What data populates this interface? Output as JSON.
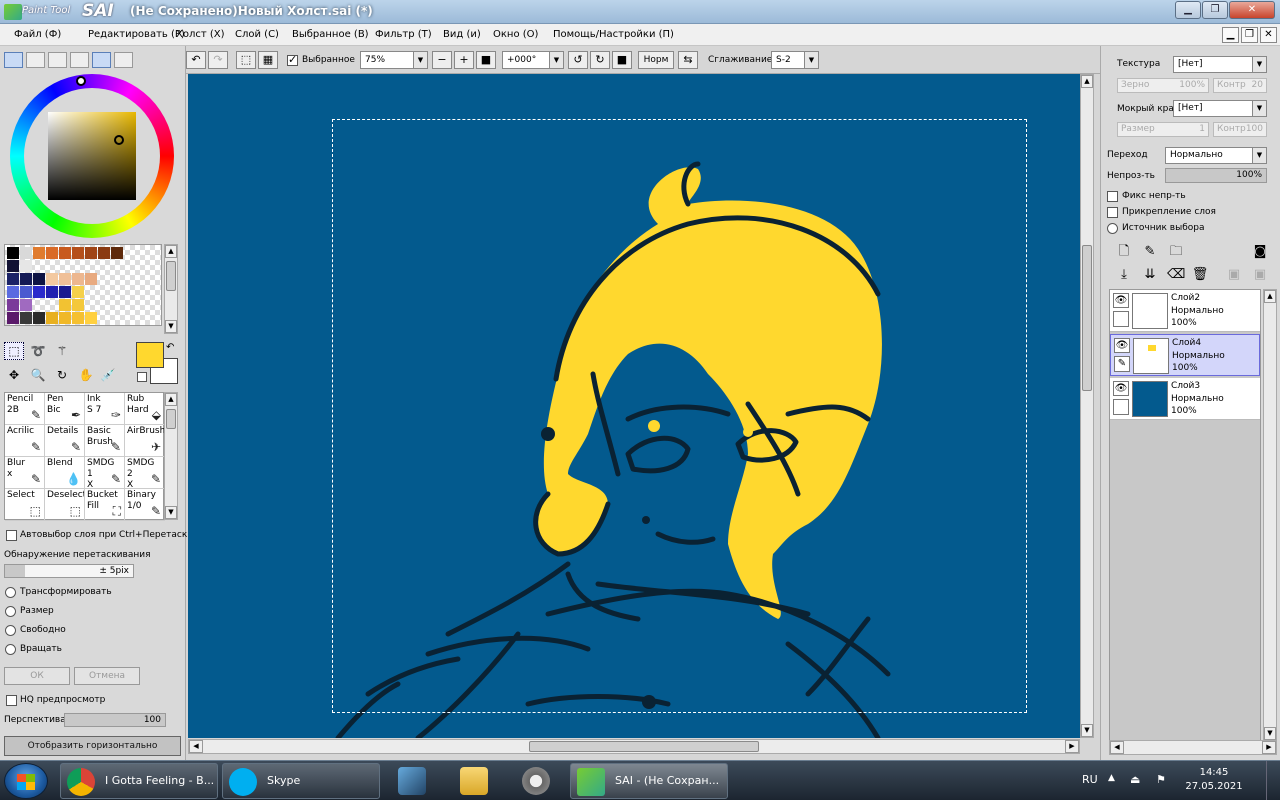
{
  "window": {
    "logo_small": "Paint Tool",
    "logo_big": "SAI",
    "title": "(Не Сохранено)Новый Холст.sai (*)",
    "buttons": [
      "minimize",
      "maximize",
      "close"
    ]
  },
  "menu": [
    "Файл (Ф)",
    "Редактировать (Р)",
    "Холст (Х)",
    "Слой (С)",
    "Выбранное (В)",
    "Фильтр (Т)",
    "Вид (и)",
    "Окно (О)",
    "Помощь/Настройки (П)"
  ],
  "toolbar": {
    "selected_label": "Выбранное",
    "selected_checked": true,
    "zoom": "75%",
    "rotation": "+000°",
    "mode": "Норм",
    "smoothing_label": "Сглаживание",
    "smoothing": "S-2"
  },
  "colors": {
    "canvas_bg": "#035a8e",
    "foreground": "#ffd82e",
    "background": "#ffffff",
    "hair": "#ffd82e"
  },
  "swatches": [
    {
      "color": "#000000"
    },
    {
      "color": "#d9d9d9"
    },
    {
      "color": "#e07b2e"
    },
    {
      "color": "#d96a27"
    },
    {
      "color": "#c85a1e"
    },
    {
      "color": "#b54f1a"
    },
    {
      "color": "#a04416"
    },
    {
      "color": "#8a3a12"
    },
    {
      "color": "#5e2a0c"
    },
    {
      "color": "#111133"
    },
    {
      "color": "#e6e6e6"
    },
    {
      "color": "#1b2266"
    },
    {
      "color": "#141a55"
    },
    {
      "color": "#0e1444"
    },
    {
      "color": "#f3c9a0"
    },
    {
      "color": "#f0c098"
    },
    {
      "color": "#edb78f"
    },
    {
      "color": "#e8aa80"
    },
    {
      "color": "#5a6ae0"
    },
    {
      "color": "#4a5ad0"
    },
    {
      "color": "#2a2acc"
    },
    {
      "color": "#2020b0"
    },
    {
      "color": "#1a1a90"
    },
    {
      "color": "#f5d04a"
    },
    {
      "color": "#7a3a9a"
    },
    {
      "color": "#a06ac0"
    },
    {
      "color": "#f2c232"
    },
    {
      "color": "#f4c83a"
    },
    {
      "color": "#5a1a6a"
    },
    {
      "color": "#3a3a3a"
    },
    {
      "color": "#2a2a2a"
    },
    {
      "color": "#e8b020"
    },
    {
      "color": "#f0b828"
    },
    {
      "color": "#f5c030"
    },
    {
      "color": "#ffd040"
    }
  ],
  "tools": [
    "selection-icon",
    "lasso-icon",
    "magic-wand-icon",
    "move-icon",
    "zoom-icon",
    "rotate-icon",
    "hand-icon",
    "eyedropper-icon"
  ],
  "brushes": [
    {
      "name": "Pencil",
      "size": "2B"
    },
    {
      "name": "Pen",
      "size": "Bic"
    },
    {
      "name": "Ink",
      "size": "S 7"
    },
    {
      "name": "Rub",
      "size": "Hard"
    },
    {
      "name": "Acrilic",
      "size": ""
    },
    {
      "name": "Details",
      "size": ""
    },
    {
      "name": "Basic",
      "size": "Brush"
    },
    {
      "name": "AirBrush",
      "size": ""
    },
    {
      "name": "Blur",
      "size": "x"
    },
    {
      "name": "Blend",
      "size": ""
    },
    {
      "name": "SMDG 1",
      "size": "X"
    },
    {
      "name": "SMDG 2",
      "size": "X"
    },
    {
      "name": "Select",
      "size": ""
    },
    {
      "name": "Deselect",
      "size": ""
    },
    {
      "name": "Bucket",
      "size": "Fill"
    },
    {
      "name": "Binary",
      "size": "1/0"
    }
  ],
  "left_options": {
    "auto_select": "Автовыбор слоя при Ctrl+Перетаскиван",
    "drag_detect": "Обнаружение перетаскивания",
    "drag_value": "± 5pix",
    "transform": "Трансформировать",
    "size": "Размер",
    "free": "Свободно",
    "rotate": "Вращать",
    "ok": "ОК",
    "cancel": "Отмена",
    "hq_preview": "HQ предпросмотр",
    "perspective": "Перспектива",
    "perspective_value": "100",
    "flip": "Отобразить горизонтально"
  },
  "right_panel": {
    "texture_label": "Текстура",
    "texture_value": "[Нет]",
    "grain_label": "Зерно",
    "grain_value": "100%",
    "contrast_label": "Контр",
    "contrast_value": "20",
    "wet_edge_label": "Мокрый край",
    "wet_edge_value": "[Нет]",
    "size_label": "Размер",
    "size_value": "1",
    "contrast2_label": "Контр",
    "contrast2_value": "100",
    "blend_label": "Переход",
    "blend_value": "Нормально",
    "opacity_label": "Непроз-ть",
    "opacity_value": "100%",
    "fix_opacity": "Фикс непр-ть",
    "clip_layer": "Прикрепление слоя",
    "selection_source": "Источник выбора"
  },
  "layers": [
    {
      "name": "Слой2",
      "mode": "Нормально",
      "opacity": "100%",
      "selected": false
    },
    {
      "name": "Слой4",
      "mode": "Нормально",
      "opacity": "100%",
      "selected": true
    },
    {
      "name": "Слой3",
      "mode": "Нормально",
      "opacity": "100%",
      "selected": false
    }
  ],
  "taskbar": {
    "items": [
      {
        "label": "I Gotta Feeling - B...",
        "icon": "chrome-icon"
      },
      {
        "label": "Skype",
        "icon": "skype-icon"
      },
      {
        "label": "SAI - (Не Сохран...",
        "icon": "sai-icon"
      }
    ],
    "pinned": [
      "network-tool-icon",
      "folder-icon",
      "media-player-icon"
    ],
    "language": "RU",
    "time": "14:45",
    "date": "27.05.2021"
  }
}
